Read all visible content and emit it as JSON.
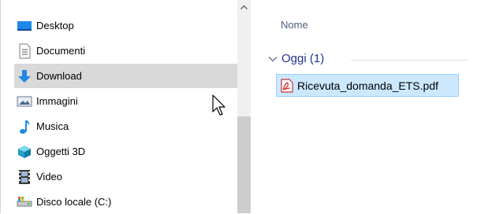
{
  "nav": {
    "items": [
      {
        "label": "Desktop",
        "icon": "desktop-icon"
      },
      {
        "label": "Documenti",
        "icon": "documents-icon"
      },
      {
        "label": "Download",
        "icon": "download-icon",
        "selected": true
      },
      {
        "label": "Immagini",
        "icon": "pictures-icon"
      },
      {
        "label": "Musica",
        "icon": "music-icon"
      },
      {
        "label": "Oggetti 3D",
        "icon": "objects-3d-icon"
      },
      {
        "label": "Video",
        "icon": "video-icon"
      },
      {
        "label": "Disco locale (C:)",
        "icon": "local-disk-icon"
      }
    ]
  },
  "scrollbar": {
    "up_arrow": "^"
  },
  "content": {
    "column_header": "Nome",
    "group": {
      "label": "Oggi (1)",
      "expanded": true
    },
    "files": [
      {
        "name": "Ricevuta_domanda_ETS.pdf",
        "icon": "pdf-icon",
        "selected": true
      }
    ]
  },
  "colors": {
    "selection_nav": "#d9d9d9",
    "selection_file": "#cce8ff",
    "selection_file_border": "#99d1ff",
    "group_header": "#1e3287",
    "column_header": "#4c607a"
  }
}
